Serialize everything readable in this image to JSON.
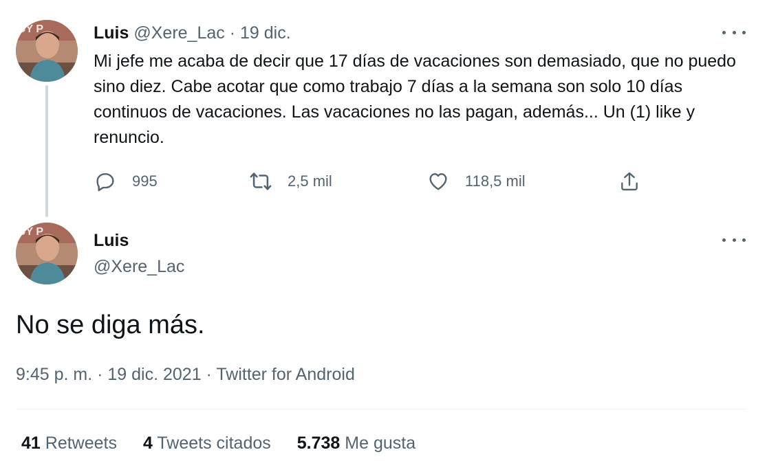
{
  "tweet1": {
    "name": "Luis",
    "handle": "@Xere_Lac",
    "separator": "·",
    "date": "19 dic.",
    "text": "Mi jefe me acaba de decir que 17 días de vacaciones son demasiado, que no puedo sino diez. Cabe acotar que como trabajo 7 días a la semana son solo 10 días continuos de vacaciones. Las vacaciones no las pagan, además... Un (1) like y renuncio.",
    "actions": {
      "reply": {
        "icon": "reply-icon",
        "count": "995"
      },
      "retweet": {
        "icon": "retweet-icon",
        "count": "2,5 mil"
      },
      "like": {
        "icon": "heart-icon",
        "count": "118,5 mil"
      },
      "share": {
        "icon": "share-icon"
      }
    },
    "more_icon": "more-icon"
  },
  "tweet2": {
    "name": "Luis",
    "handle": "@Xere_Lac",
    "text": "No se diga más.",
    "meta": "9:45 p. m. · 19 dic. 2021 · Twitter for Android",
    "more_icon": "more-icon",
    "stats": {
      "retweets_count": "41",
      "retweets_label": "Retweets",
      "quotes_count": "4",
      "quotes_label": "Tweets citados",
      "likes_count": "5.738",
      "likes_label": "Me gusta"
    }
  },
  "colors": {
    "text": "#0f1419",
    "muted": "#536471",
    "thread_line": "#cfd9de",
    "divider": "#eff3f4"
  }
}
